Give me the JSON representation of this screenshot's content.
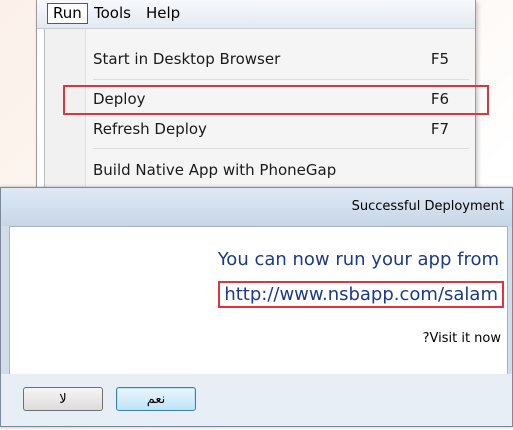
{
  "menubar": {
    "items": [
      {
        "label": "Run",
        "open": true
      },
      {
        "label": "Tools"
      },
      {
        "label": "Help"
      }
    ]
  },
  "run_menu": {
    "items": [
      {
        "label": "Start in Desktop Browser",
        "shortcut": "F5"
      },
      {
        "label": "Deploy",
        "shortcut": "F6",
        "highlighted": true
      },
      {
        "label": "Refresh Deploy",
        "shortcut": "F7"
      },
      {
        "label": "Build Native App with PhoneGap",
        "shortcut": ""
      }
    ]
  },
  "dialog": {
    "title": "Successful Deployment",
    "message_line1": "You can now run your app from",
    "url": "http://www.nsbapp.com/salam",
    "question": "?Visit it now",
    "yes_button": "نعم",
    "no_button": "لا"
  },
  "colors": {
    "highlight_border": "#e0333c",
    "message_text": "#1c3a8c"
  }
}
